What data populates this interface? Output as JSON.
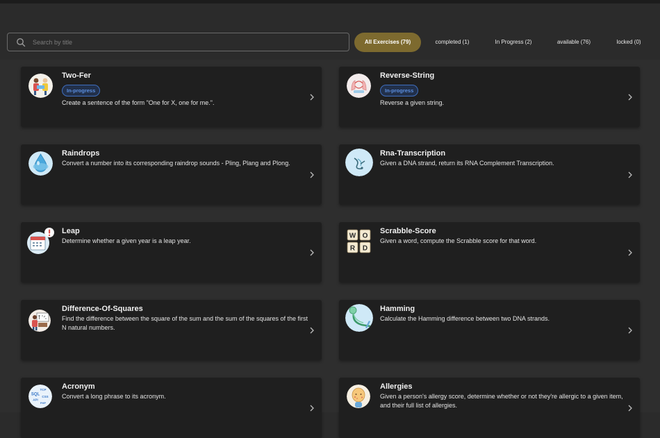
{
  "search": {
    "placeholder": "Search by title",
    "value": ""
  },
  "filters": [
    {
      "label": "All Exercises (79)",
      "active": true
    },
    {
      "label": "completed (1)",
      "active": false
    },
    {
      "label": "In Progress (2)",
      "active": false
    },
    {
      "label": "available (76)",
      "active": false
    },
    {
      "label": "locked (0)",
      "active": false
    }
  ],
  "colors": {
    "accent": "#7d6a2f",
    "badge": "#5b8fe0",
    "card": "#1f1f1f"
  },
  "exercises": [
    {
      "title": "Two-Fer",
      "badge": "In-progress",
      "description": "Create a sentence of the form \"One for X, one for me.\".",
      "icon": "two-fer-icon"
    },
    {
      "title": "Reverse-String",
      "badge": "In-progress",
      "description": "Reverse a given string.",
      "icon": "reverse-string-icon"
    },
    {
      "title": "Raindrops",
      "badge": "",
      "description": "Convert a number into its corresponding raindrop sounds - Pling, Plang and Plong.",
      "icon": "raindrop-icon"
    },
    {
      "title": "Rna-Transcription",
      "badge": "",
      "description": "Given a DNA strand, return its RNA Complement Transcription.",
      "icon": "rna-icon"
    },
    {
      "title": "Leap",
      "badge": "",
      "description": "Determine whether a given year is a leap year.",
      "icon": "calendar-icon"
    },
    {
      "title": "Scrabble-Score",
      "badge": "",
      "description": "Given a word, compute the Scrabble score for that word.",
      "icon": "scrabble-tiles-icon",
      "tiles": [
        "W",
        "O",
        "R",
        "D"
      ]
    },
    {
      "title": "Difference-Of-Squares",
      "badge": "",
      "description": "Find the difference between the square of the sum and the sum of the squares of the first N natural numbers.",
      "icon": "math-board-icon"
    },
    {
      "title": "Hamming",
      "badge": "",
      "description": "Calculate the Hamming difference between two DNA strands.",
      "icon": "hamming-icon"
    },
    {
      "title": "Acronym",
      "badge": "",
      "description": "Convert a long phrase to its acronym.",
      "icon": "acronym-icon",
      "words": [
        "TCP",
        "SQL",
        "CSS",
        "API",
        "PHP"
      ]
    },
    {
      "title": "Allergies",
      "badge": "",
      "description": "Given a person's allergy score, determine whether or not they're allergic to a given item, and their full list of allergies.",
      "icon": "allergies-icon"
    }
  ]
}
